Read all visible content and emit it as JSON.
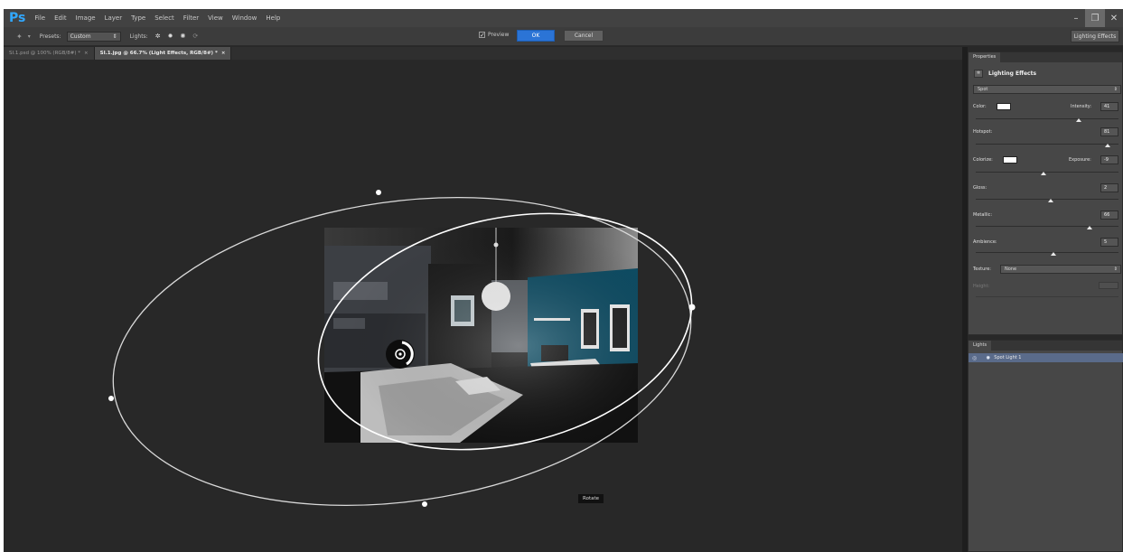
{
  "app": {
    "logo": "Ps"
  },
  "menu": [
    "File",
    "Edit",
    "Image",
    "Layer",
    "Type",
    "Select",
    "Filter",
    "View",
    "Window",
    "Help"
  ],
  "window_controls": {
    "minimize": "–",
    "restore": "❐",
    "close": "✕"
  },
  "options": {
    "presets_label": "Presets:",
    "presets_value": "Custom",
    "lights_label": "Lights:",
    "preview_label": "Preview",
    "preview_checked": true,
    "ok_label": "OK",
    "cancel_label": "Cancel",
    "workspace_label": "Lighting Effects"
  },
  "tabs": [
    {
      "label": "SI.1.psd @ 100% (RGB/8#) *",
      "active": false
    },
    {
      "label": "SI.1.jpg @ 66.7% (Light Effects, RGB/8#) *",
      "active": true
    }
  ],
  "canvas": {
    "tooltip": "Rotate"
  },
  "properties": {
    "tab": "Properties",
    "title": "Lighting Effects",
    "light_type": "Spot",
    "color_label": "Color:",
    "color_value": "#ffffff",
    "intensity_label": "Intensity:",
    "intensity_value": "41",
    "hotspot_label": "Hotspot:",
    "hotspot_value": "81",
    "colorize_label": "Colorize:",
    "colorize_value": "#ffffff",
    "exposure_label": "Exposure:",
    "exposure_value": "-9",
    "gloss_label": "Gloss:",
    "gloss_value": "2",
    "metallic_label": "Metallic:",
    "metallic_value": "66",
    "ambience_label": "Ambience:",
    "ambience_value": "5",
    "texture_label": "Texture:",
    "texture_value": "None",
    "height_label": "Height:"
  },
  "lights_panel": {
    "tab": "Lights",
    "items": [
      {
        "name": "Spot Light 1"
      }
    ]
  },
  "colors": {
    "accent": "#2b74d6",
    "logo": "#31a8ff",
    "selection": "#5a6b8a"
  }
}
